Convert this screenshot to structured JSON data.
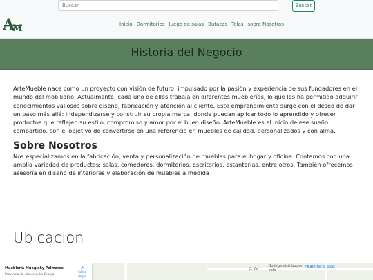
{
  "search": {
    "placeholder": "Buscar",
    "button_label": "Buscar"
  },
  "logo": {
    "text": "AM"
  },
  "nav": {
    "items": [
      "Inicio",
      "Dormitorios",
      "Juego de salas",
      "Butacas",
      "Telas",
      "sobre Nosotros"
    ]
  },
  "banner": {
    "title": "Historia del Negocio"
  },
  "history": {
    "text": "ArteMueble nace como un proyecto con visión de futuro, impulsado por la pasión y experiencia de sus fundadores en el mundo del mobiliario. Actualmente, cada uno de ellos trabaja en diferentes mueblerías, lo que les ha permitido adquirir conocimientos valiosos sobre diseño, fabricación y atención al cliente. Este emprendimiento surge con el deseo de dar un paso más allá: independizarse y construir su propia marca, donde puedan aplicar todo lo aprendido y ofrecer productos que reflejen su estilo, compromiso y amor por el buen diseño. ArteMueble es el inicio de ese sueño compartido, con el objetivo de convertirse en una referencia en muebles de calidad, personalizados y con alma."
  },
  "about": {
    "heading": "Sobre Nosotros",
    "text": "Nos especializamos en la fabricación, venta y personalización de muebles para el hogar y oficina. Contamos con una amplia variedad de productos: salas, comedores, dormitorios, escritorios, estanterías, entre otros. También ofrecemos asesoría en diseño de interiores y elaboración de muebles a medida"
  },
  "location": {
    "heading": "Ubicacion"
  },
  "map": {
    "place_name": "Muebleria Mueglaky Palmares",
    "address": "Provincia de Alajuela, La Granja",
    "directions_label": "Cómo llegar",
    "labels": [
      "Bodega distribución big cola",
      "Baterías & Spas",
      "C. Va"
    ]
  },
  "colors": {
    "banner": "#5a7f5c",
    "accent": "#198754",
    "nav_text": "#3b6a4a"
  }
}
